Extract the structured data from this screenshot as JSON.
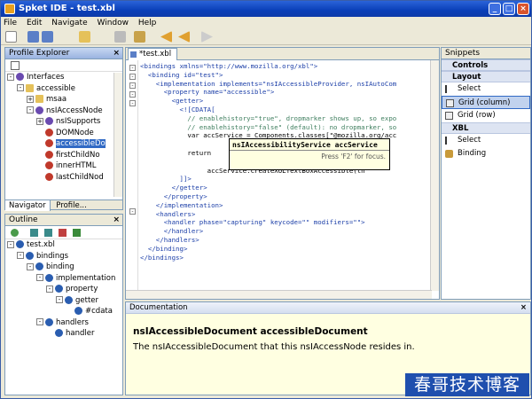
{
  "window": {
    "title": "Spket IDE - test.xbl"
  },
  "menu": [
    "File",
    "Edit",
    "Navigate",
    "Window",
    "Help"
  ],
  "profile_explorer": {
    "title": "Profile Explorer",
    "items": [
      {
        "label": "Interfaces",
        "depth": 0,
        "expander": "-",
        "icon": "interface-icon"
      },
      {
        "label": "accessible",
        "depth": 1,
        "expander": "-",
        "icon": "folder-icon"
      },
      {
        "label": "msaa",
        "depth": 2,
        "expander": "+",
        "icon": "folder-icon"
      },
      {
        "label": "nsIAccessNode",
        "depth": 2,
        "expander": "-",
        "icon": "interface-icon"
      },
      {
        "label": "nsISupports",
        "depth": 3,
        "expander": "+",
        "icon": "interface-icon"
      },
      {
        "label": "DOMNode",
        "depth": 3,
        "expander": "",
        "icon": "property-icon"
      },
      {
        "label": "accessibleDo",
        "depth": 3,
        "expander": "",
        "icon": "property-icon",
        "selected": true
      },
      {
        "label": "firstChildNo",
        "depth": 3,
        "expander": "",
        "icon": "property-icon"
      },
      {
        "label": "innerHTML",
        "depth": 3,
        "expander": "",
        "icon": "property-icon"
      },
      {
        "label": "lastChildNod",
        "depth": 3,
        "expander": "",
        "icon": "property-icon"
      }
    ],
    "tabs": [
      "Navigator",
      "Profile..."
    ]
  },
  "outline": {
    "title": "Outline",
    "items": [
      {
        "label": "test.xbl",
        "depth": 0,
        "expander": "-"
      },
      {
        "label": "bindings",
        "depth": 1,
        "expander": "-"
      },
      {
        "label": "binding",
        "depth": 2,
        "expander": "-"
      },
      {
        "label": "implementation",
        "depth": 3,
        "expander": "-"
      },
      {
        "label": "property",
        "depth": 4,
        "expander": "-"
      },
      {
        "label": "getter",
        "depth": 5,
        "expander": "-"
      },
      {
        "label": "#cdata",
        "depth": 6,
        "expander": ""
      },
      {
        "label": "handlers",
        "depth": 3,
        "expander": "-"
      },
      {
        "label": "handler",
        "depth": 4,
        "expander": ""
      }
    ]
  },
  "editor": {
    "tab": "*test.xbl",
    "lines": [
      "<bindings xmlns=\"http://www.mozilla.org/xbl\">",
      "  <binding id=\"test\">",
      "    <implementation implements=\"nsIAccessibleProvider, nsIAutoCom",
      "      <property name=\"accessible\">",
      "        <getter>",
      "          <![CDATA[",
      "            // enablehistory=\"true\", dropmarker shows up, so expo",
      "            // enablehistory=\"false\" (default): no dropmarker, so",
      "            var accService = Components.classes[\"@mozilla.org/acc",
      "                                                     faces.ns",
      "            return                                   = 'true'",
      "                                                     ssible(th",
      "                 accService.createXULTextBoxAccessible(th",
      "          ]]>",
      "        </getter>",
      "      </property>",
      "    </implementation>",
      "    <handlers>",
      "      <handler phase=\"capturing\" keycode=\"\" modifiers=\"\">",
      "      </handler>",
      "    </handlers>",
      "  </binding>",
      "</bindings>"
    ],
    "popup": {
      "signature": "nsIAccessibilityService accService",
      "footer": "Press 'F2' for focus."
    }
  },
  "snippets": {
    "title": "Snippets",
    "groups": [
      {
        "label": "Controls",
        "items": []
      },
      {
        "label": "Layout",
        "items": [
          "Select",
          "Grid (column)",
          "Grid (row)"
        ]
      },
      {
        "label": "XBL",
        "items": [
          "Select",
          "Binding"
        ]
      }
    ]
  },
  "documentation": {
    "title": "Documentation",
    "heading": "nsIAccessibleDocument accessibleDocument",
    "text": "The nsIAccessibleDocument that this nsIAccessNode resides in."
  },
  "watermark": "春哥技术博客"
}
